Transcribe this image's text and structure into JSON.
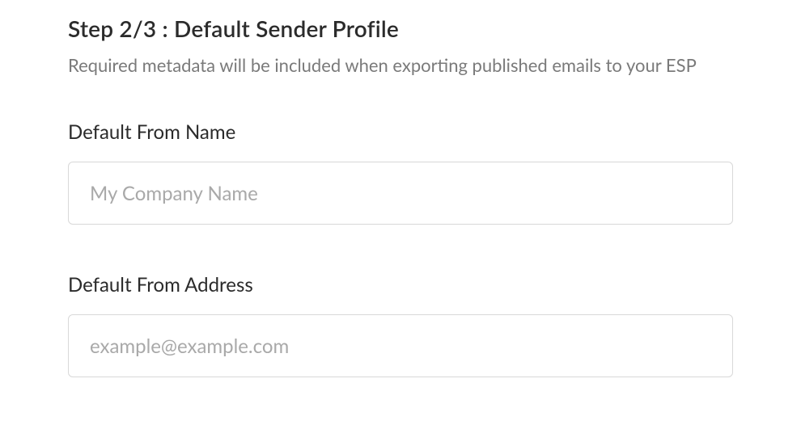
{
  "header": {
    "title": "Step 2/3 : Default Sender Profile",
    "subtitle": "Required metadata will be included when exporting published emails to your ESP"
  },
  "form": {
    "from_name": {
      "label": "Default From Name",
      "placeholder": "My Company Name",
      "value": ""
    },
    "from_address": {
      "label": "Default From Address",
      "placeholder": "example@example.com",
      "value": ""
    }
  }
}
